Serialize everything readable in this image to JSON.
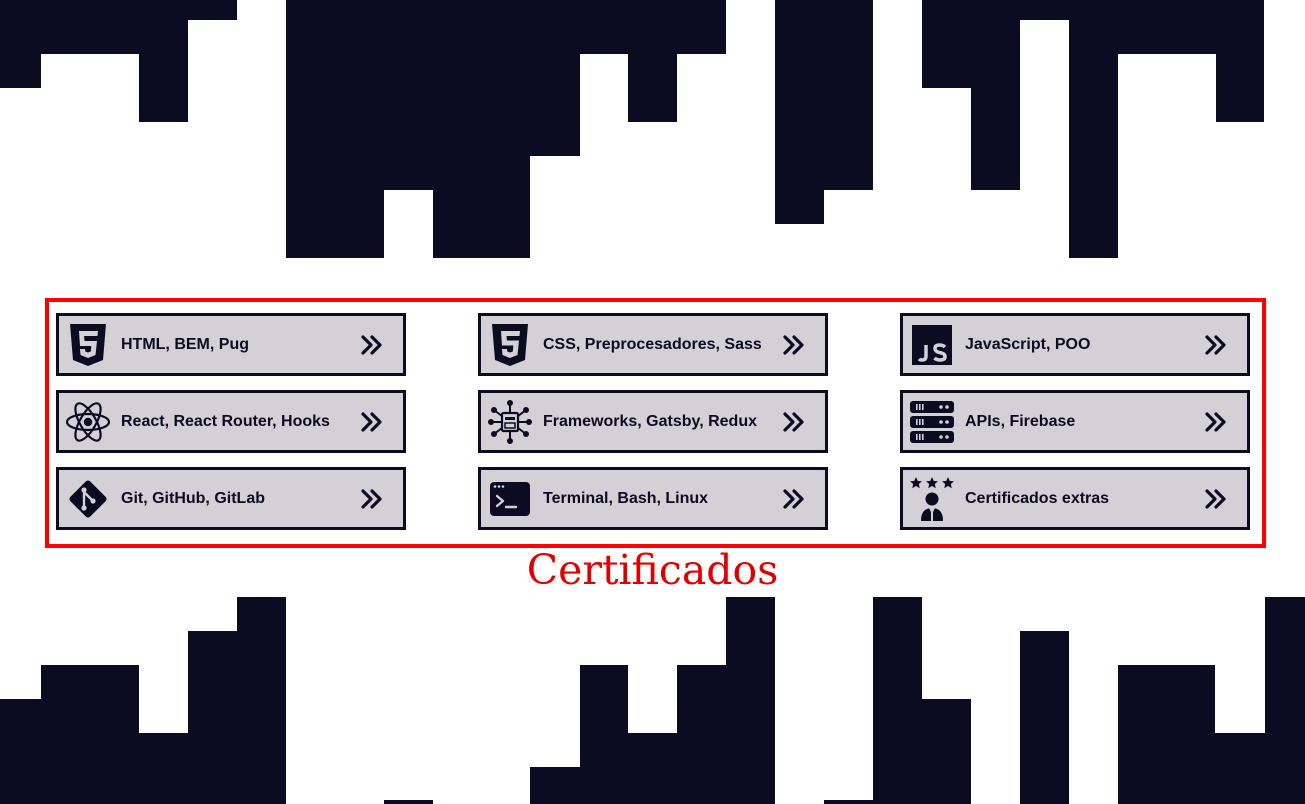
{
  "section": {
    "title": "Certificados",
    "border_color": "#ff0000",
    "title_color": "#e00000"
  },
  "colors": {
    "block": "#0b0c22",
    "card_bg": "#d3d1d6",
    "background": "#ffffff"
  },
  "cards": [
    {
      "label": "HTML, BEM, Pug",
      "icon": "html5-icon"
    },
    {
      "label": "CSS, Preprocesadores, Sass",
      "icon": "css3-icon"
    },
    {
      "label": "JavaScript, POO",
      "icon": "javascript-icon"
    },
    {
      "label": "React, React Router, Hooks",
      "icon": "react-icon"
    },
    {
      "label": "Frameworks, Gatsby, Redux",
      "icon": "network-chip-icon"
    },
    {
      "label": "APIs, Firebase",
      "icon": "server-icon"
    },
    {
      "label": "Git, GitHub, GitLab",
      "icon": "git-icon"
    },
    {
      "label": "Terminal, Bash, Linux",
      "icon": "terminal-icon"
    },
    {
      "label": "Certificados extras",
      "icon": "user-stars-icon"
    }
  ]
}
